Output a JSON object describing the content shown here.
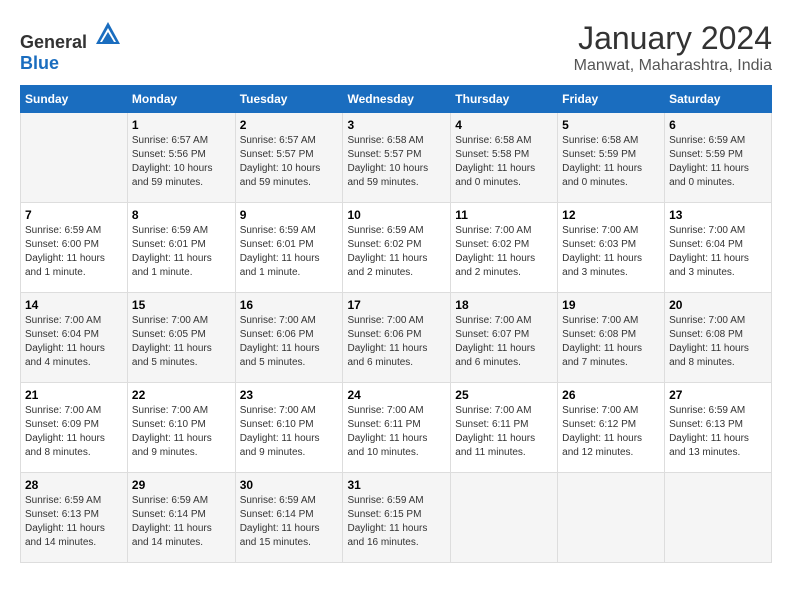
{
  "header": {
    "logo_general": "General",
    "logo_blue": "Blue",
    "title": "January 2024",
    "subtitle": "Manwat, Maharashtra, India"
  },
  "days_of_week": [
    "Sunday",
    "Monday",
    "Tuesday",
    "Wednesday",
    "Thursday",
    "Friday",
    "Saturday"
  ],
  "weeks": [
    [
      {
        "day": "",
        "info": ""
      },
      {
        "day": "1",
        "info": "Sunrise: 6:57 AM\nSunset: 5:56 PM\nDaylight: 10 hours\nand 59 minutes."
      },
      {
        "day": "2",
        "info": "Sunrise: 6:57 AM\nSunset: 5:57 PM\nDaylight: 10 hours\nand 59 minutes."
      },
      {
        "day": "3",
        "info": "Sunrise: 6:58 AM\nSunset: 5:57 PM\nDaylight: 10 hours\nand 59 minutes."
      },
      {
        "day": "4",
        "info": "Sunrise: 6:58 AM\nSunset: 5:58 PM\nDaylight: 11 hours\nand 0 minutes."
      },
      {
        "day": "5",
        "info": "Sunrise: 6:58 AM\nSunset: 5:59 PM\nDaylight: 11 hours\nand 0 minutes."
      },
      {
        "day": "6",
        "info": "Sunrise: 6:59 AM\nSunset: 5:59 PM\nDaylight: 11 hours\nand 0 minutes."
      }
    ],
    [
      {
        "day": "7",
        "info": "Sunrise: 6:59 AM\nSunset: 6:00 PM\nDaylight: 11 hours\nand 1 minute."
      },
      {
        "day": "8",
        "info": "Sunrise: 6:59 AM\nSunset: 6:01 PM\nDaylight: 11 hours\nand 1 minute."
      },
      {
        "day": "9",
        "info": "Sunrise: 6:59 AM\nSunset: 6:01 PM\nDaylight: 11 hours\nand 1 minute."
      },
      {
        "day": "10",
        "info": "Sunrise: 6:59 AM\nSunset: 6:02 PM\nDaylight: 11 hours\nand 2 minutes."
      },
      {
        "day": "11",
        "info": "Sunrise: 7:00 AM\nSunset: 6:02 PM\nDaylight: 11 hours\nand 2 minutes."
      },
      {
        "day": "12",
        "info": "Sunrise: 7:00 AM\nSunset: 6:03 PM\nDaylight: 11 hours\nand 3 minutes."
      },
      {
        "day": "13",
        "info": "Sunrise: 7:00 AM\nSunset: 6:04 PM\nDaylight: 11 hours\nand 3 minutes."
      }
    ],
    [
      {
        "day": "14",
        "info": "Sunrise: 7:00 AM\nSunset: 6:04 PM\nDaylight: 11 hours\nand 4 minutes."
      },
      {
        "day": "15",
        "info": "Sunrise: 7:00 AM\nSunset: 6:05 PM\nDaylight: 11 hours\nand 5 minutes."
      },
      {
        "day": "16",
        "info": "Sunrise: 7:00 AM\nSunset: 6:06 PM\nDaylight: 11 hours\nand 5 minutes."
      },
      {
        "day": "17",
        "info": "Sunrise: 7:00 AM\nSunset: 6:06 PM\nDaylight: 11 hours\nand 6 minutes."
      },
      {
        "day": "18",
        "info": "Sunrise: 7:00 AM\nSunset: 6:07 PM\nDaylight: 11 hours\nand 6 minutes."
      },
      {
        "day": "19",
        "info": "Sunrise: 7:00 AM\nSunset: 6:08 PM\nDaylight: 11 hours\nand 7 minutes."
      },
      {
        "day": "20",
        "info": "Sunrise: 7:00 AM\nSunset: 6:08 PM\nDaylight: 11 hours\nand 8 minutes."
      }
    ],
    [
      {
        "day": "21",
        "info": "Sunrise: 7:00 AM\nSunset: 6:09 PM\nDaylight: 11 hours\nand 8 minutes."
      },
      {
        "day": "22",
        "info": "Sunrise: 7:00 AM\nSunset: 6:10 PM\nDaylight: 11 hours\nand 9 minutes."
      },
      {
        "day": "23",
        "info": "Sunrise: 7:00 AM\nSunset: 6:10 PM\nDaylight: 11 hours\nand 9 minutes."
      },
      {
        "day": "24",
        "info": "Sunrise: 7:00 AM\nSunset: 6:11 PM\nDaylight: 11 hours\nand 10 minutes."
      },
      {
        "day": "25",
        "info": "Sunrise: 7:00 AM\nSunset: 6:11 PM\nDaylight: 11 hours\nand 11 minutes."
      },
      {
        "day": "26",
        "info": "Sunrise: 7:00 AM\nSunset: 6:12 PM\nDaylight: 11 hours\nand 12 minutes."
      },
      {
        "day": "27",
        "info": "Sunrise: 6:59 AM\nSunset: 6:13 PM\nDaylight: 11 hours\nand 13 minutes."
      }
    ],
    [
      {
        "day": "28",
        "info": "Sunrise: 6:59 AM\nSunset: 6:13 PM\nDaylight: 11 hours\nand 14 minutes."
      },
      {
        "day": "29",
        "info": "Sunrise: 6:59 AM\nSunset: 6:14 PM\nDaylight: 11 hours\nand 14 minutes."
      },
      {
        "day": "30",
        "info": "Sunrise: 6:59 AM\nSunset: 6:14 PM\nDaylight: 11 hours\nand 15 minutes."
      },
      {
        "day": "31",
        "info": "Sunrise: 6:59 AM\nSunset: 6:15 PM\nDaylight: 11 hours\nand 16 minutes."
      },
      {
        "day": "",
        "info": ""
      },
      {
        "day": "",
        "info": ""
      },
      {
        "day": "",
        "info": ""
      }
    ]
  ]
}
